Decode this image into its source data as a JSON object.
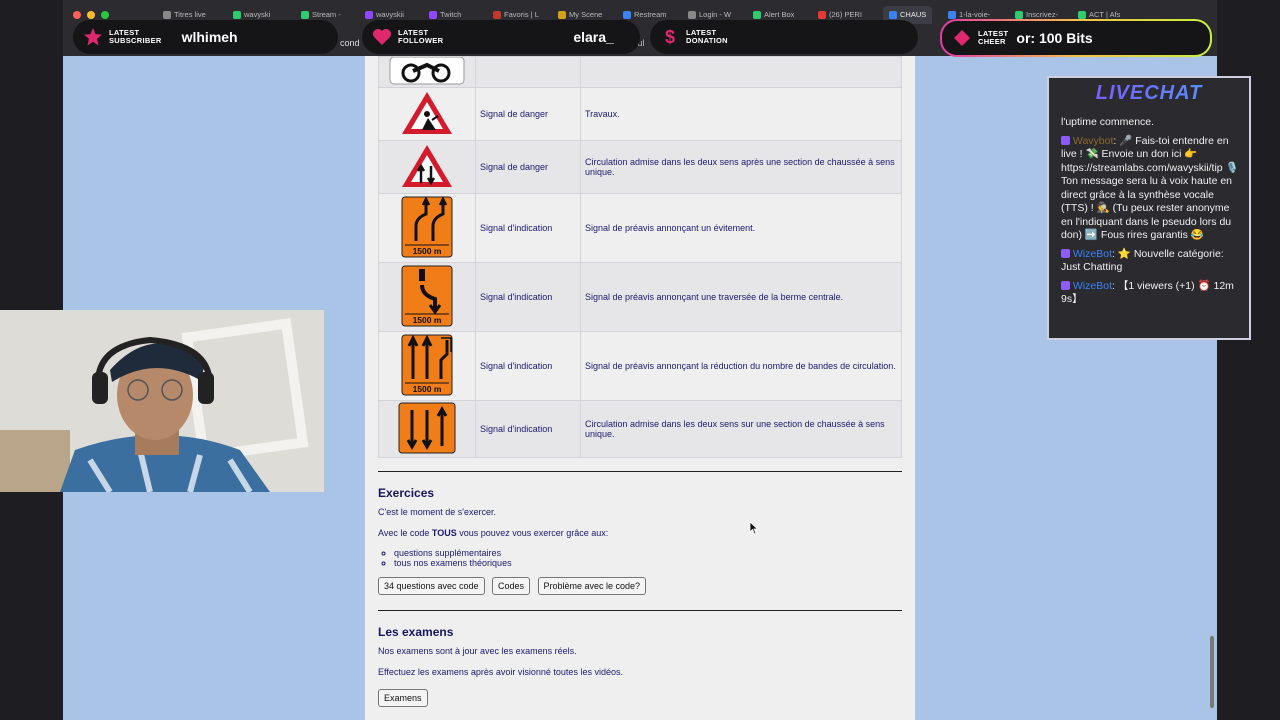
{
  "browser": {
    "tabs": [
      {
        "label": "Titres live",
        "color": "#888888"
      },
      {
        "label": "wavyski",
        "color": "#2ecc71"
      },
      {
        "label": "Stream - ",
        "color": "#2ecc71"
      },
      {
        "label": "wavyskii",
        "color": "#9146ff"
      },
      {
        "label": "Twitch",
        "color": "#9146ff"
      },
      {
        "label": "Favoris | L",
        "color": "#c0392b"
      },
      {
        "label": "My Scene",
        "color": "#d4a017"
      },
      {
        "label": "Restream",
        "color": "#3b82f6"
      },
      {
        "label": "Login - W",
        "color": "#888888"
      },
      {
        "label": "Alert Box",
        "color": "#2ecc71"
      },
      {
        "label": "(26) PERI",
        "color": "#e53935"
      },
      {
        "label": "CHAUS",
        "color": "#3b82f6"
      },
      {
        "label": "1-la-voie-",
        "color": "#3b82f6"
      },
      {
        "label": "Inscrivez-",
        "color": "#2ecc71"
      },
      {
        "label": "ACT | Afs",
        "color": "#2ecc71"
      }
    ],
    "address_fragment_left": "cond",
    "address_fragment_right": "ircul"
  },
  "overlay": {
    "subscriber": {
      "label1": "LATEST",
      "label2": "SUBSCRIBER",
      "value": "wlhimeh"
    },
    "follower": {
      "label1": "LATEST",
      "label2": "FOLLOWER",
      "value": "elara_"
    },
    "donation": {
      "label1": "LATEST",
      "label2": "DONATION",
      "value": ""
    },
    "cheer": {
      "label1": "LATEST",
      "label2": "CHEER",
      "value": "or: 100 Bits"
    }
  },
  "signs_table": [
    {
      "icon": "motorcycle-sign",
      "category": "",
      "description": ""
    },
    {
      "icon": "roadworks-sign",
      "category": "Signal de danger",
      "description": "Travaux."
    },
    {
      "icon": "two-way-traffic-sign",
      "category": "Signal de danger",
      "description": "Circulation admise dans les deux sens après une section de chaussée à sens unique."
    },
    {
      "icon": "lane-shift-sign",
      "category": "Signal d'indication",
      "description": "Signal de préavis annonçant un évitement.",
      "distance": "1500 m"
    },
    {
      "icon": "median-crossing-sign",
      "category": "Signal d'indication",
      "description": "Signal de préavis annonçant une traversée de la berme centrale.",
      "distance": "1500 m"
    },
    {
      "icon": "lane-reduction-sign",
      "category": "Signal d'indication",
      "description": "Signal de préavis annonçant la réduction du nombre de bandes de circulation.",
      "distance": "1500 m"
    },
    {
      "icon": "two-way-section-sign",
      "category": "Signal d'indication",
      "description": "Circulation admise dans les deux sens sur une section de chaussée à sens unique."
    }
  ],
  "exercices": {
    "title": "Exercices",
    "intro": "C'est le moment de s'exercer.",
    "code_line_pre": "Avec le code ",
    "code_word": "TOUS",
    "code_line_post": " vous pouvez vous exercer grâce aux:",
    "items": [
      "questions supplémentaires",
      "tous nos examens théoriques"
    ],
    "buttons": [
      "34 questions avec code",
      "Codes",
      "Problème avec le code?"
    ]
  },
  "examens": {
    "title": "Les examens",
    "line1": "Nos examens sont à jour avec les examens réels.",
    "line2": "Effectuez les examens après avoir visionné toutes les vidéos.",
    "button": "Examens"
  },
  "chat": {
    "title": "LIVECHAT",
    "line0": "l'uptime commence.",
    "msg1_user": "Wavybot",
    "msg1_text": ": 🎤 Fais-toi entendre en live ! 💸 Envoie un don ici 👉 https://streamlabs.com/wavyskii/tip 🎙️ Ton message sera lu à voix haute en direct grâce à la synthèse vocale (TTS) ! 🕵️ (Tu peux rester anonyme en l'indiquant dans le pseudo lors du don) ➡️ Fous rires garantis 😂",
    "msg2_user": "WizeBot",
    "msg2_text": ": ⭐ Nouvelle catégorie: Just Chatting",
    "msg3_user": "WizeBot",
    "msg3_text": ": 【1 viewers (+1) ⏰ 12m 9s】"
  }
}
